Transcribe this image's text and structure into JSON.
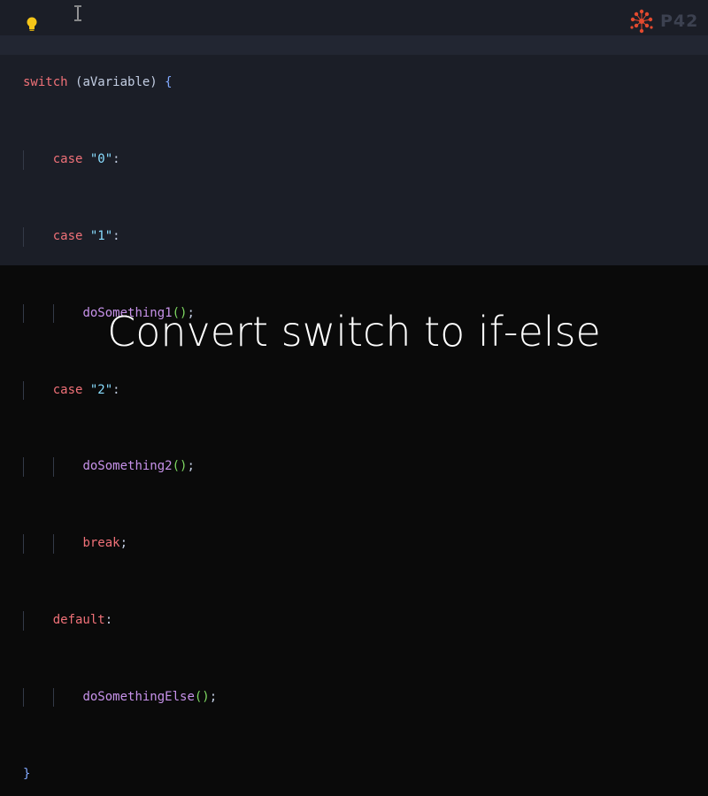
{
  "brand": {
    "logo_text": "P42"
  },
  "icons": {
    "lightbulb": "lightbulb-icon",
    "cursor": "text-cursor-icon",
    "logo_mark": "p42-logo-icon"
  },
  "colors": {
    "keyword": "#f07178",
    "string": "#89ddff",
    "function": "#c792ea",
    "brace": "#82aaff",
    "parens": "#7fd962",
    "bulb": "#f5c518",
    "logo": "#e34a2f"
  },
  "code": {
    "l1": {
      "kw": "switch",
      "open": " (",
      "var": "aVariable",
      "close": ") ",
      "brace": "{"
    },
    "l2": {
      "kw": "case",
      "str": "\"0\"",
      "colon": ":"
    },
    "l3": {
      "kw": "case",
      "str": "\"1\"",
      "colon": ":"
    },
    "l4": {
      "fn": "doSomething1",
      "parens": "()",
      "semi": ";"
    },
    "l5": {
      "kw": "case",
      "str": "\"2\"",
      "colon": ":"
    },
    "l6": {
      "fn": "doSomething2",
      "parens": "()",
      "semi": ";"
    },
    "l7": {
      "kw": "break",
      "semi": ";"
    },
    "l8": {
      "kw": "default",
      "colon": ":"
    },
    "l9": {
      "fn": "doSomethingElse",
      "parens": "()",
      "semi": ";"
    },
    "l10": {
      "brace": "}"
    }
  },
  "caption": "Convert switch to if-else"
}
